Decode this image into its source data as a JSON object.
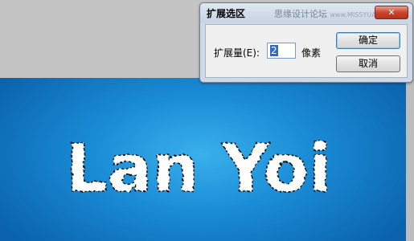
{
  "dialog": {
    "title": "扩展选区",
    "watermark_main": "思缘设计论坛",
    "watermark_site": "www.MISSYUAN.COM",
    "close_glyph": "✕",
    "expand_label": "扩展量(E):",
    "expand_value": "2",
    "unit_label": "像素",
    "ok_label": "确定",
    "cancel_label": "取消"
  },
  "canvas": {
    "text": "Lan Yoi",
    "background_colors": [
      "#3ab0ec",
      "#1a8cd6",
      "#0b63ad"
    ],
    "text_color": "#ffffff",
    "selection_outline": "marching-ants"
  }
}
